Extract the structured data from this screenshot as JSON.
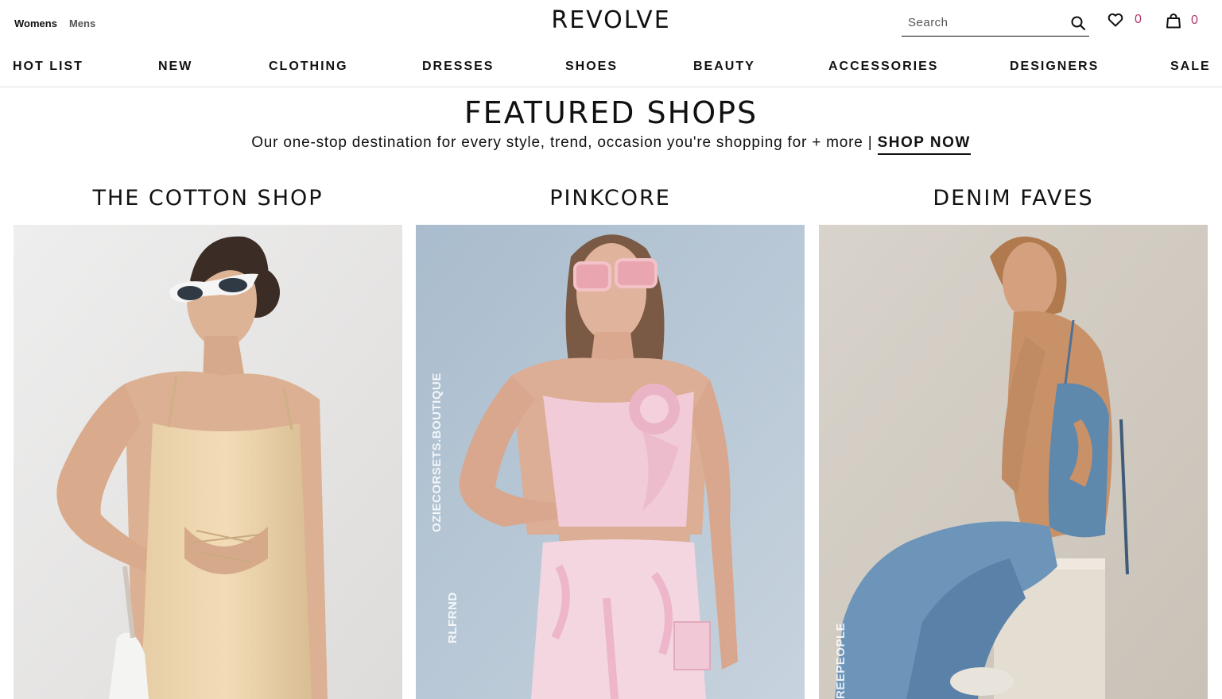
{
  "header": {
    "gender_tabs": [
      "Womens",
      "Mens"
    ],
    "logo": "REVOLVE",
    "search_placeholder": "Search",
    "wishlist_count": "0",
    "bag_count": "0"
  },
  "nav": {
    "items": [
      "HOT LIST",
      "NEW",
      "CLOTHING",
      "DRESSES",
      "SHOES",
      "BEAUTY",
      "ACCESSORIES",
      "DESIGNERS",
      "SALE"
    ]
  },
  "featured": {
    "title": "FEATURED SHOPS",
    "subtitle": "Our one-stop destination for every style, trend, occasion you're shopping for + more |",
    "cta": "SHOP NOW"
  },
  "shops": [
    {
      "title": "THE COTTON SHOP",
      "watermark": ""
    },
    {
      "title": "PINKCORE",
      "watermark": "OZIECORSETS.BOUTIQUE",
      "watermark2": "RLFRND"
    },
    {
      "title": "DENIM FAVES",
      "watermark": "REEPEOPLE"
    }
  ],
  "icons": {
    "search": "search-icon",
    "wishlist": "heart-icon",
    "bag": "bag-icon"
  },
  "colors": {
    "count_accent": "#b0386a",
    "text": "#111111"
  }
}
